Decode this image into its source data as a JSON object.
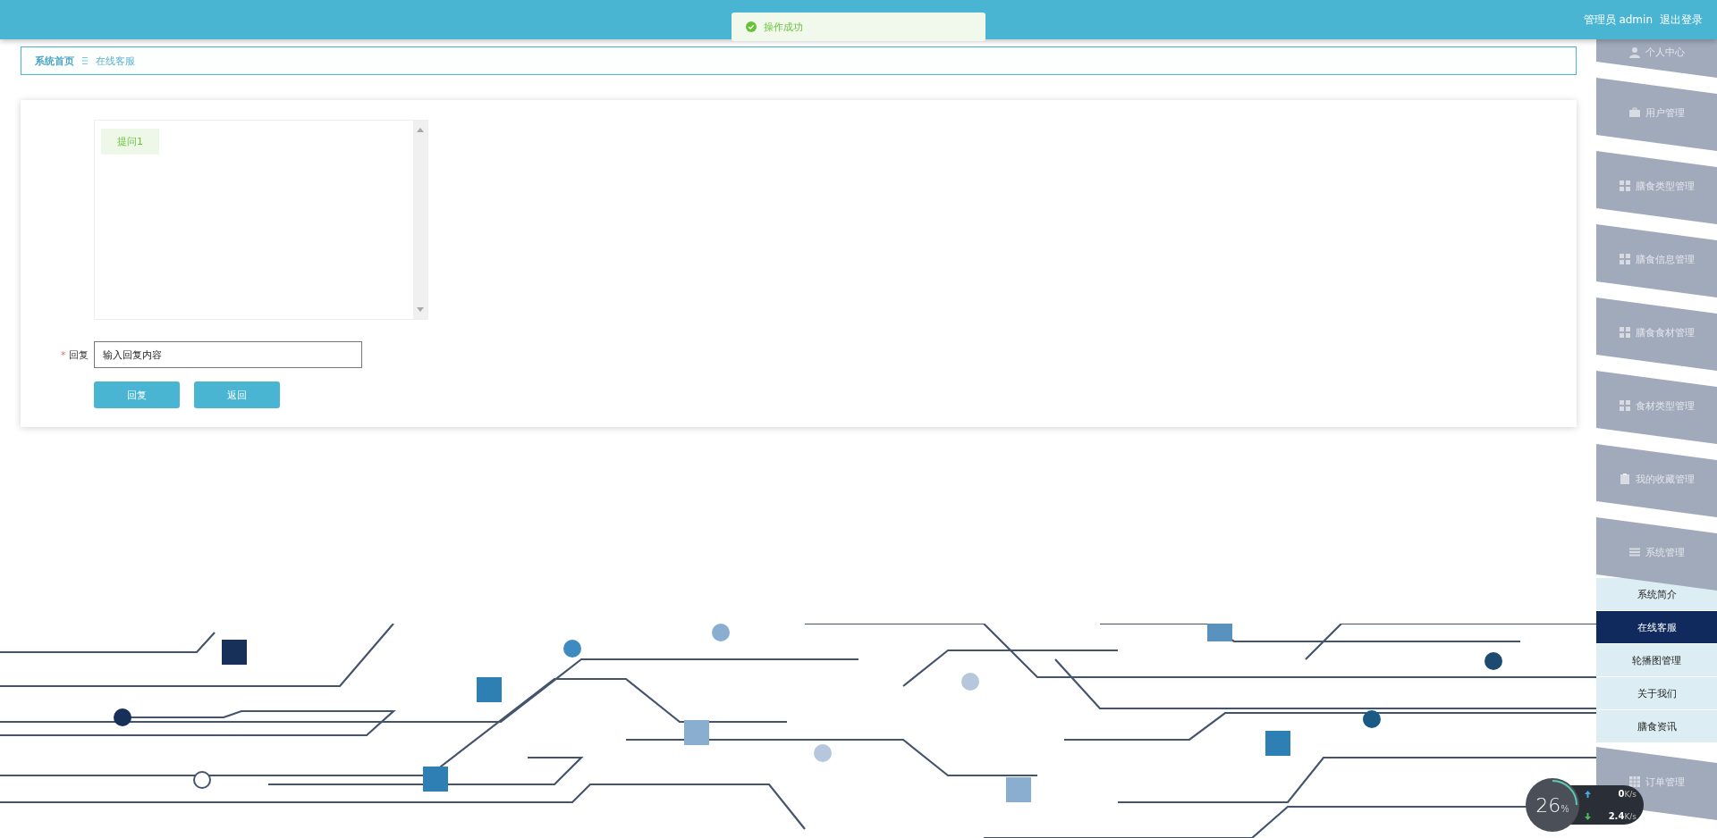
{
  "header": {
    "user_label": "管理员 admin",
    "logout": "退出登录"
  },
  "toast": {
    "message": "操作成功"
  },
  "breadcrumb": [
    {
      "label": "系统首页"
    },
    {
      "label": "在线客服"
    }
  ],
  "chat": {
    "messages": [
      {
        "text": "提问1"
      }
    ]
  },
  "form": {
    "required_mark": "*",
    "reply_label": "回复",
    "reply_placeholder": "输入回复内容",
    "buttons": [
      "回复",
      "返回"
    ]
  },
  "sidebar": {
    "items": [
      {
        "label": "个人中心"
      },
      {
        "label": "用户管理"
      },
      {
        "label": "膳食类型管理"
      },
      {
        "label": "膳食信息管理"
      },
      {
        "label": "膳食食材管理"
      },
      {
        "label": "食材类型管理"
      },
      {
        "label": "我的收藏管理"
      },
      {
        "label": "系统管理",
        "expanded": true,
        "children": [
          {
            "label": "系统简介",
            "selected": false
          },
          {
            "label": "在线客服",
            "selected": true
          },
          {
            "label": "轮播图管理",
            "selected": false
          },
          {
            "label": "关于我们",
            "selected": false
          },
          {
            "label": "膳食资讯",
            "selected": false
          }
        ]
      },
      {
        "label": "订单管理"
      }
    ]
  },
  "network_widget": {
    "cpu": "26",
    "cpu_unit": "%",
    "upload": "0",
    "upload_unit": "K/s",
    "download": "2.4",
    "download_unit": "K/s"
  }
}
